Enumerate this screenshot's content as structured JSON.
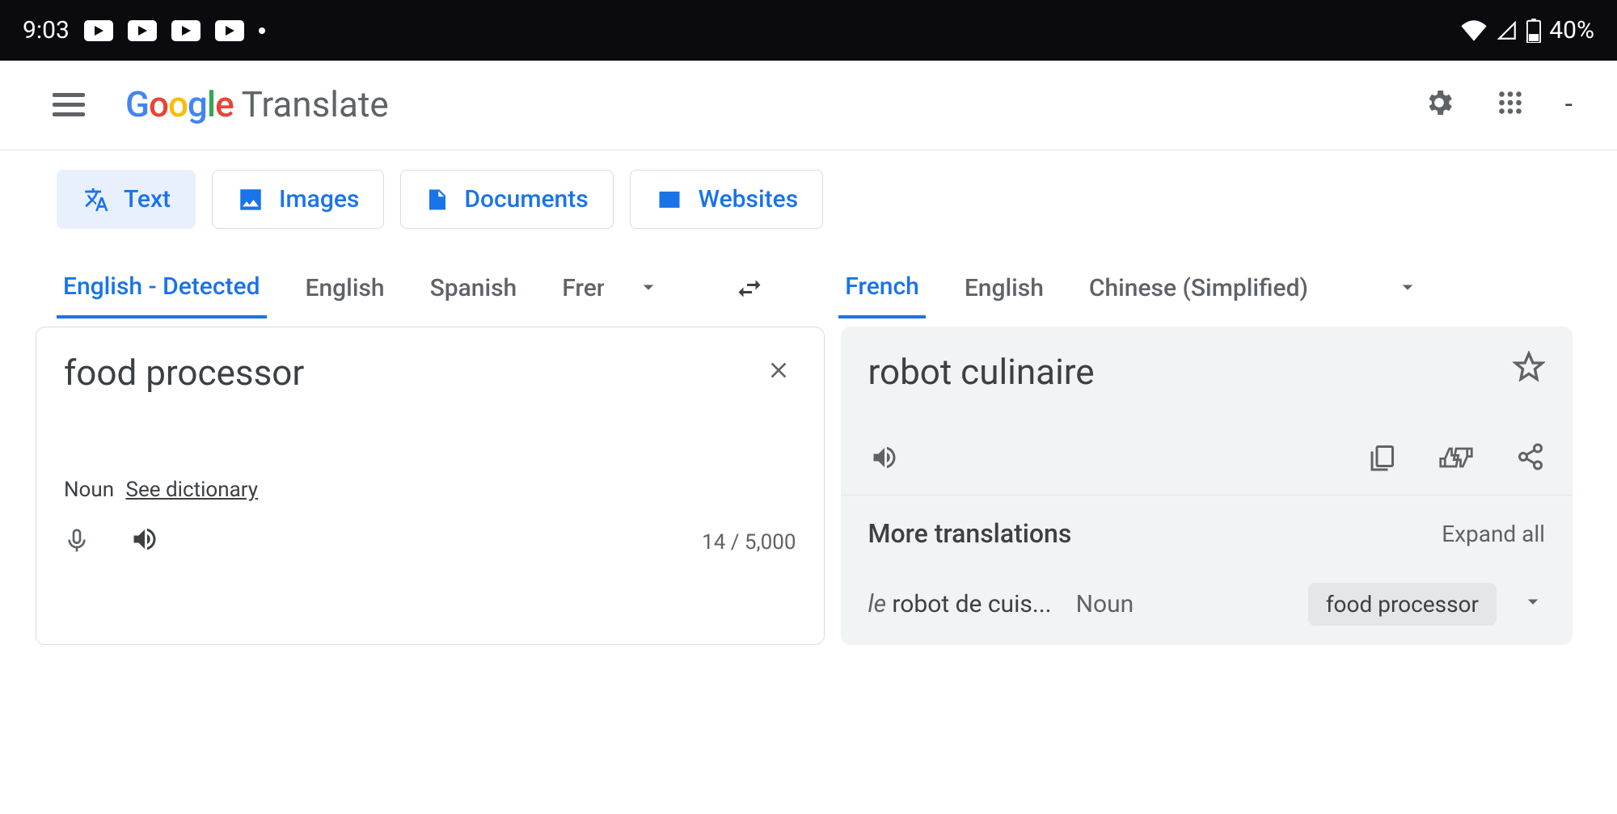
{
  "status": {
    "time": "9:03",
    "battery": "40%"
  },
  "header": {
    "brand": "Google",
    "product": "Translate"
  },
  "tabs": [
    {
      "label": "Text",
      "icon": "translate-icon",
      "active": true
    },
    {
      "label": "Images",
      "icon": "image-icon",
      "active": false
    },
    {
      "label": "Documents",
      "icon": "document-icon",
      "active": false
    },
    {
      "label": "Websites",
      "icon": "website-icon",
      "active": false
    }
  ],
  "source_langs": {
    "selected": "English - Detected",
    "others": [
      "English",
      "Spanish",
      "Fren"
    ]
  },
  "target_langs": {
    "selected": "French",
    "others": [
      "English",
      "Chinese (Simplified)"
    ]
  },
  "input": {
    "text": "food processor",
    "pos": "Noun",
    "dictionary_link": "See dictionary",
    "char_count": "14 / 5,000"
  },
  "output": {
    "text": "robot culinaire",
    "more_label": "More translations",
    "expand_label": "Expand all",
    "alt": {
      "prefix": "le ",
      "text": "robot de cuis...",
      "pos": "Noun",
      "chip": "food processor"
    }
  }
}
